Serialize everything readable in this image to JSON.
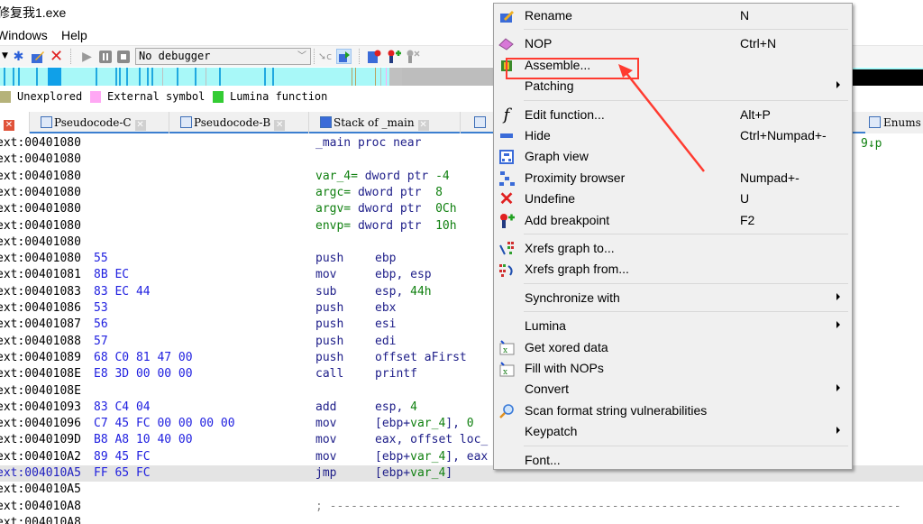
{
  "window": {
    "title": "修复我1.exe"
  },
  "menubar": {
    "items": [
      "Windows",
      "Help"
    ]
  },
  "toolbar": {
    "icons": [
      "dropdown-arrow-icon",
      "add-function-icon",
      "edit-icon",
      "delete-icon",
      "run-icon",
      "pause-icon",
      "stop-icon"
    ],
    "debugger_select": "No debugger"
  },
  "legend": {
    "items": [
      {
        "label": "Unexplored",
        "color": "#b5b27a"
      },
      {
        "label": "External symbol",
        "color": "#ffa8f4"
      },
      {
        "label": "Lumina function",
        "color": "#33cc33"
      }
    ]
  },
  "tabs": [
    {
      "label": "Pseudocode-C"
    },
    {
      "label": "Pseudocode-B"
    },
    {
      "label": "Stack of _main"
    },
    {
      "label": "Enums"
    }
  ],
  "code": {
    "lines": [
      {
        "addr": "ext:00401080",
        "bytes": "",
        "text": "_main proc near",
        "kind": "proc"
      },
      {
        "addr": "ext:00401080",
        "bytes": "",
        "text": "",
        "kind": "blank"
      },
      {
        "addr": "ext:00401080",
        "bytes": "",
        "var": "var_4=",
        "def": " dword ptr ",
        "val": "-4",
        "kind": "var"
      },
      {
        "addr": "ext:00401080",
        "bytes": "",
        "var": "argc=",
        "def": " dword ptr  ",
        "val": "8",
        "kind": "var"
      },
      {
        "addr": "ext:00401080",
        "bytes": "",
        "var": "argv=",
        "def": " dword ptr  ",
        "val": "0Ch",
        "kind": "var"
      },
      {
        "addr": "ext:00401080",
        "bytes": "",
        "var": "envp=",
        "def": " dword ptr  ",
        "val": "10h",
        "kind": "var"
      },
      {
        "addr": "ext:00401080",
        "bytes": "",
        "text": "",
        "kind": "blank"
      },
      {
        "addr": "ext:00401080",
        "bytes": "55",
        "mnem": "push",
        "ops": "ebp",
        "kind": "ins"
      },
      {
        "addr": "ext:00401081",
        "bytes": "8B EC",
        "mnem": "mov",
        "ops": "ebp, esp",
        "kind": "ins"
      },
      {
        "addr": "ext:00401083",
        "bytes": "83 EC 44",
        "mnem": "sub",
        "ops": "esp, ",
        "ops_num": "44h",
        "kind": "ins"
      },
      {
        "addr": "ext:00401086",
        "bytes": "53",
        "mnem": "push",
        "ops": "ebx",
        "kind": "ins"
      },
      {
        "addr": "ext:00401087",
        "bytes": "56",
        "mnem": "push",
        "ops": "esi",
        "kind": "ins"
      },
      {
        "addr": "ext:00401088",
        "bytes": "57",
        "mnem": "push",
        "ops": "edi",
        "kind": "ins"
      },
      {
        "addr": "ext:00401089",
        "bytes": "68 C0 81 47 00",
        "mnem": "push",
        "ops": "offset aFirst",
        "kind": "ins"
      },
      {
        "addr": "ext:0040108E",
        "bytes": "E8 3D 00 00 00",
        "mnem": "call",
        "ops": "printf",
        "kind": "ins"
      },
      {
        "addr": "ext:0040108E",
        "bytes": "",
        "text": "",
        "kind": "blank"
      },
      {
        "addr": "ext:00401093",
        "bytes": "83 C4 04",
        "mnem": "add",
        "ops": "esp, ",
        "ops_num": "4",
        "kind": "ins"
      },
      {
        "addr": "ext:00401096",
        "bytes": "C7 45 FC 00 00 00 00",
        "mnem": "mov",
        "ops": "[ebp+",
        "ops_var": "var_4",
        "ops_tail": "], ",
        "ops_num": "0",
        "kind": "ins"
      },
      {
        "addr": "ext:0040109D",
        "bytes": "B8 A8 10 40 00",
        "mnem": "mov",
        "ops": "eax, offset loc_",
        "kind": "ins"
      },
      {
        "addr": "ext:004010A2",
        "bytes": "89 45 FC",
        "mnem": "mov",
        "ops": "[ebp+",
        "ops_var": "var_4",
        "ops_tail": "], eax",
        "kind": "ins"
      },
      {
        "addr": "ext:004010A5",
        "bytes": "FF 65 FC",
        "mnem": "jmp",
        "ops": "[ebp+",
        "ops_var": "var_4",
        "ops_tail": "]",
        "kind": "ins",
        "highlight": true
      },
      {
        "addr": "ext:004010A5",
        "bytes": "",
        "text": "",
        "kind": "blank"
      },
      {
        "addr": "ext:004010A8",
        "bytes": "",
        "text": "; ---------------------------------------------------------------------------------",
        "kind": "comment"
      },
      {
        "addr": "ext:004010A8",
        "bytes": "",
        "text": "",
        "kind": "blank"
      }
    ],
    "side_fragment": "9↓p"
  },
  "context_menu": {
    "items": [
      {
        "label": "Rename",
        "shortcut": "N",
        "icon": "rename-icon"
      },
      {
        "sep": true
      },
      {
        "label": "NOP",
        "shortcut": "Ctrl+N",
        "icon": "eraser-icon"
      },
      {
        "label": "Assemble...",
        "shortcut": "",
        "icon": "chip-icon",
        "highlighted": true
      },
      {
        "label": "Patching",
        "shortcut": "",
        "submenu": true
      },
      {
        "sep": true
      },
      {
        "label": "Edit function...",
        "shortcut": "Alt+P",
        "icon": "function-icon"
      },
      {
        "label": "Hide",
        "shortcut": "Ctrl+Numpad+-",
        "icon": "hide-icon"
      },
      {
        "label": "Graph view",
        "shortcut": "",
        "icon": "graph-view-icon"
      },
      {
        "label": "Proximity browser",
        "shortcut": "Numpad+-",
        "icon": "proximity-icon"
      },
      {
        "label": "Undefine",
        "shortcut": "U",
        "icon": "undefine-icon"
      },
      {
        "label": "Add breakpoint",
        "shortcut": "F2",
        "icon": "breakpoint-icon"
      },
      {
        "sep": true
      },
      {
        "label": "Xrefs graph to...",
        "shortcut": "",
        "icon": "xrefs-to-icon"
      },
      {
        "label": "Xrefs graph from...",
        "shortcut": "",
        "icon": "xrefs-from-icon"
      },
      {
        "sep": true
      },
      {
        "label": "Synchronize with",
        "shortcut": "",
        "submenu": true
      },
      {
        "sep": true
      },
      {
        "label": "Lumina",
        "shortcut": "",
        "submenu": true
      },
      {
        "label": "Get xored data",
        "shortcut": "",
        "icon": "script-icon"
      },
      {
        "label": "Fill with NOPs",
        "shortcut": "",
        "icon": "script-icon"
      },
      {
        "label": "Convert",
        "shortcut": "",
        "submenu": true
      },
      {
        "label": "Scan format string vulnerabilities",
        "shortcut": "",
        "icon": "magnifier-icon"
      },
      {
        "label": "Keypatch",
        "shortcut": "",
        "submenu": true
      },
      {
        "sep": true
      },
      {
        "label": "Font...",
        "shortcut": ""
      }
    ]
  },
  "annotation": {
    "color": "#ff3b30",
    "target": "Assemble..."
  }
}
